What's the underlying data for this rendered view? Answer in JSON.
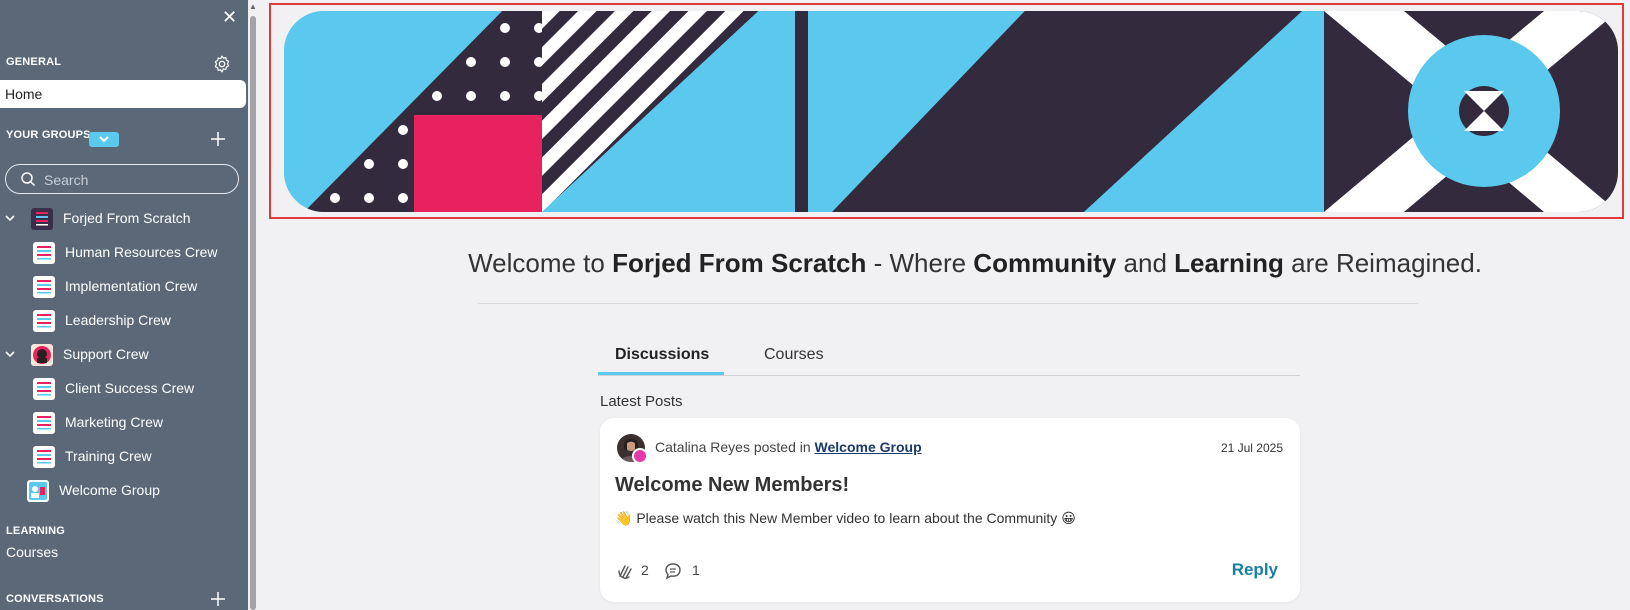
{
  "sidebar": {
    "close_icon": "close-icon",
    "general_label": "GENERAL",
    "home_label": "Home",
    "your_groups_label": "YOUR GROUPS",
    "search_placeholder": "Search",
    "groups": [
      {
        "label": "Forjed From Scratch",
        "level": 0,
        "expandable": true
      },
      {
        "label": "Human Resources Crew",
        "level": 1
      },
      {
        "label": "Implementation Crew",
        "level": 1
      },
      {
        "label": "Leadership Crew",
        "level": 1
      },
      {
        "label": "Support Crew",
        "level": 0,
        "expandable": true
      },
      {
        "label": "Client Success Crew",
        "level": 1
      },
      {
        "label": "Marketing Crew",
        "level": 1
      },
      {
        "label": "Training Crew",
        "level": 1
      },
      {
        "label": "Welcome Group",
        "level": 0
      }
    ],
    "learning_label": "LEARNING",
    "courses_label": "Courses",
    "conversations_label": "CONVERSATIONS"
  },
  "welcome": {
    "prefix": "Welcome to ",
    "community_name": "Forjed From Scratch",
    "middle1": " - Where ",
    "word_community": "Community",
    "middle2": " and ",
    "word_learning": "Learning",
    "suffix": " are Reimagined."
  },
  "tabs": [
    {
      "label": "Discussions",
      "active": true
    },
    {
      "label": "Courses",
      "active": false
    }
  ],
  "latest_posts_label": "Latest Posts",
  "post": {
    "author": "Catalina Reyes",
    "posted_in_text": " posted in ",
    "group": "Welcome Group",
    "date": "21 Jul 2025",
    "title": "Welcome New Members!",
    "body": "👋 Please watch this New Member video to learn about the Community 😀",
    "claps": "2",
    "comments": "1",
    "reply_label": "Reply"
  },
  "colors": {
    "sidebar_bg": "#5a6878",
    "accent_blue": "#5bc8ee",
    "banner_dark": "#342a3d",
    "banner_pink": "#e8225e",
    "reply_link": "#1b7fa0"
  }
}
